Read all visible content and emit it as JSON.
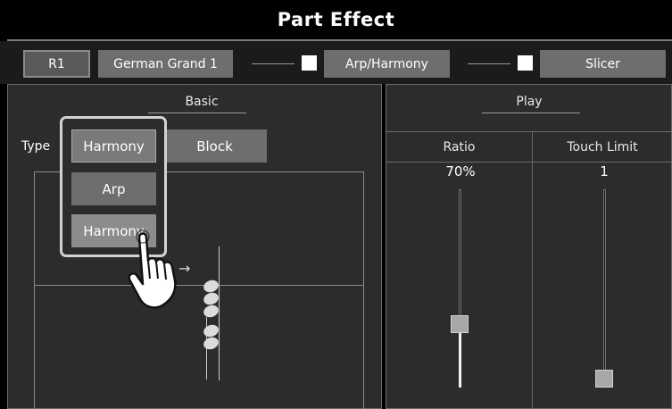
{
  "window": {
    "title": "Part Effect"
  },
  "top_row": {
    "part_label": "R1",
    "voice_label": "German Grand 1",
    "arp_harmony_label": "Arp/Harmony",
    "slicer_label": "Slicer"
  },
  "basic": {
    "title": "Basic",
    "type_label": "Type",
    "current_type": "Harmony",
    "block_label": "Block",
    "type_options": [
      "Arp",
      "Harmony"
    ]
  },
  "play": {
    "title": "Play",
    "ratio": {
      "label": "Ratio",
      "value": "70%",
      "level": 0.3
    },
    "touch_limit": {
      "label": "Touch Limit",
      "value": "1",
      "level": 0.0
    }
  },
  "icons": [
    "hand-pointer-icon",
    "music-note-icon",
    "right-arrow-icon"
  ],
  "colors": {
    "button": "#6e6e6e",
    "panel": "#2c2c2c",
    "popup_border": "#d2d2d2"
  }
}
